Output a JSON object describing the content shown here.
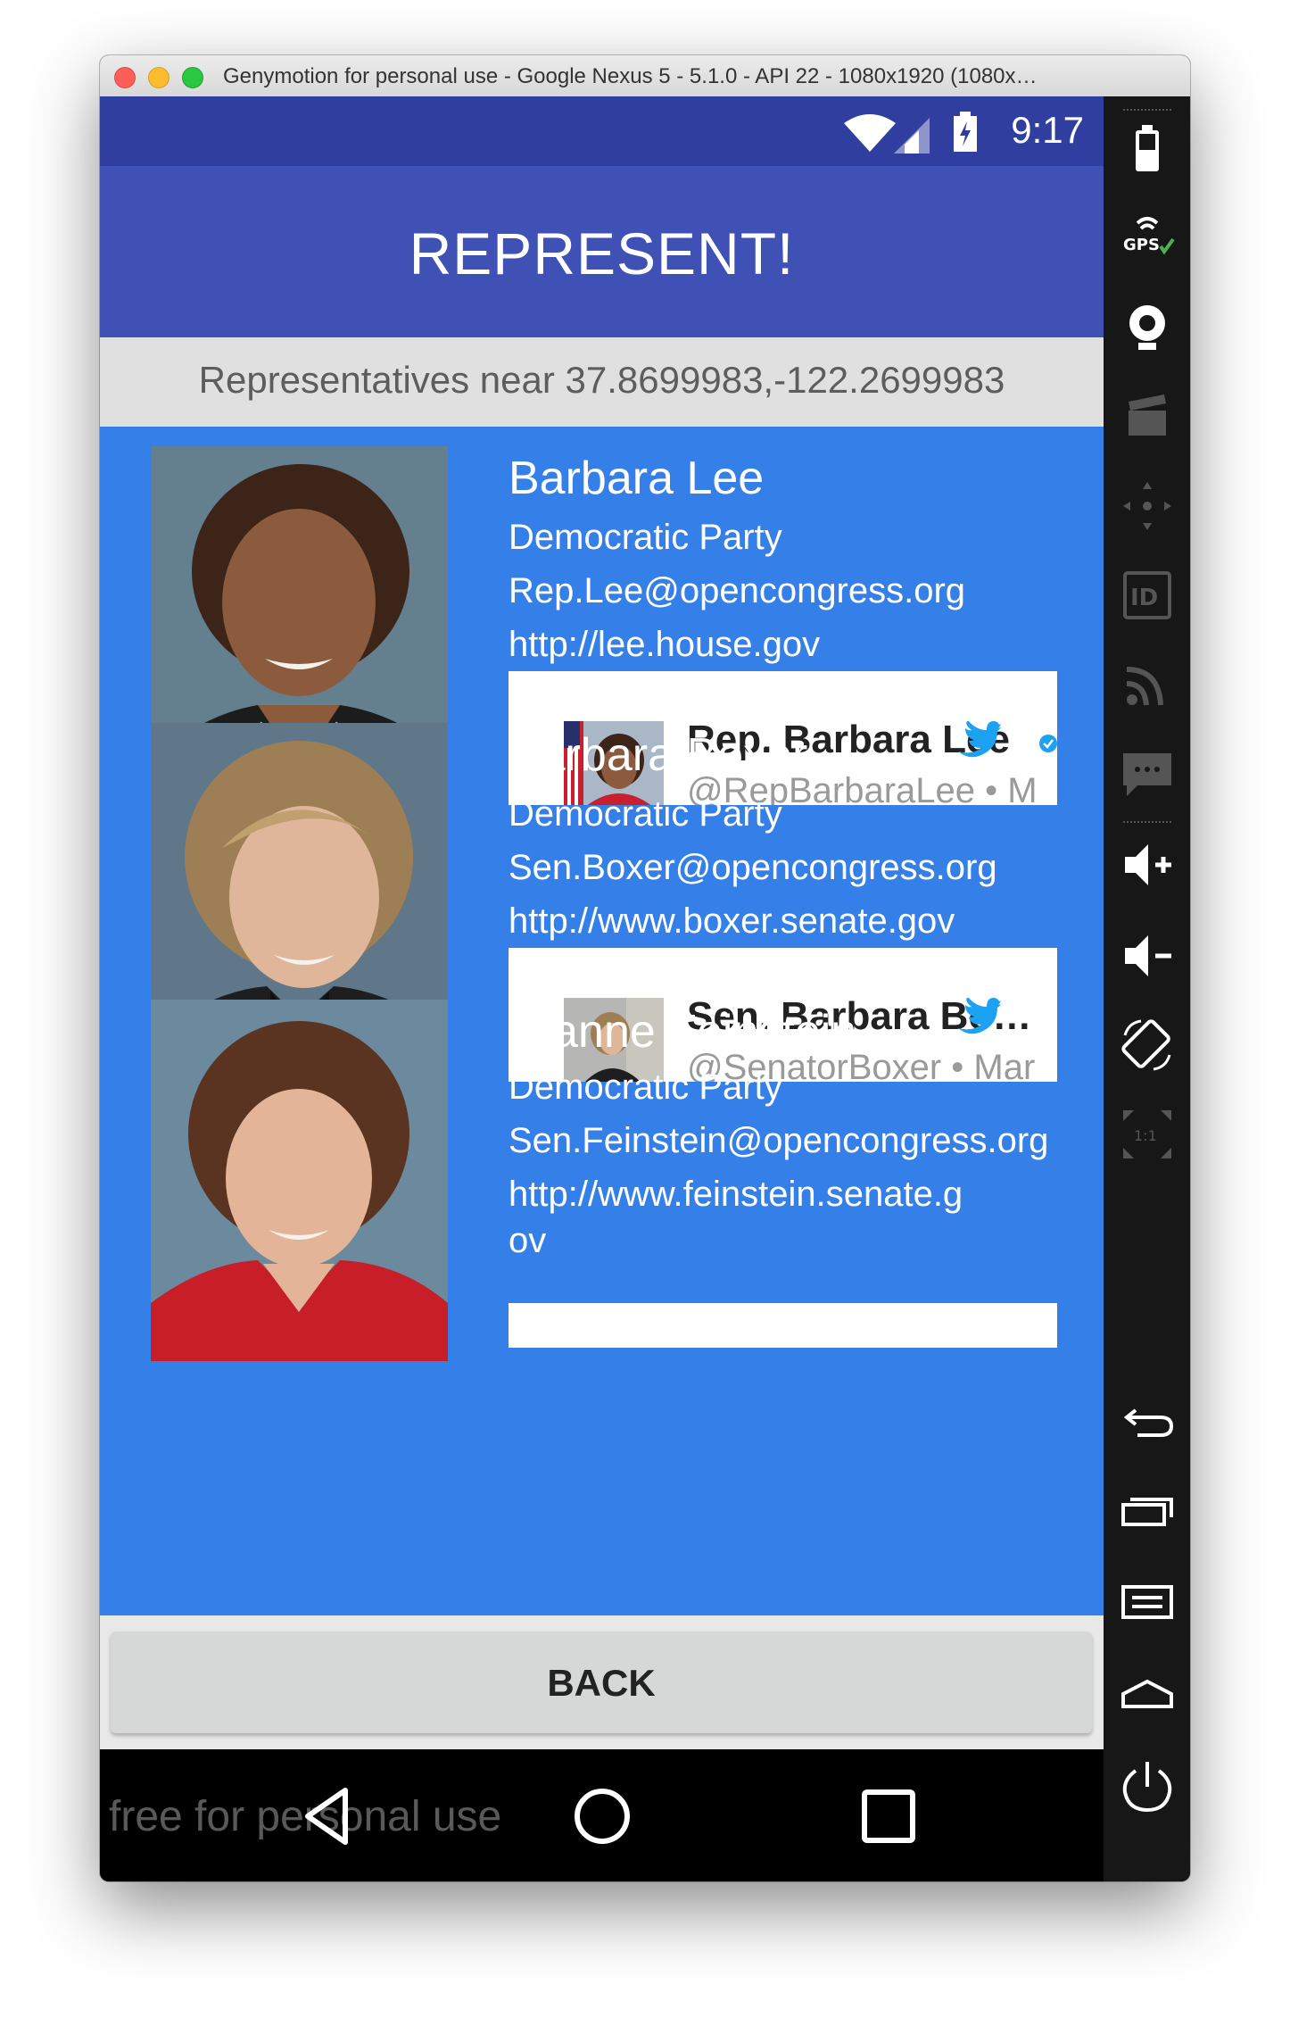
{
  "window": {
    "title": "Genymotion for personal use - Google Nexus 5 - 5.1.0 - API 22 - 1080x1920 (1080x…"
  },
  "status_bar": {
    "time": "9:17"
  },
  "app": {
    "title": "REPRESENT!",
    "subheader": "Representatives near 37.8699983,-122.2699983",
    "back_label": "BACK"
  },
  "representatives": [
    {
      "name": "Barbara Lee",
      "party": "Democratic Party",
      "email": "Rep.Lee@opencongress.org",
      "website": "http://lee.house.gov",
      "tweet": {
        "display_name": "Rep. Barbara Lee",
        "handle": "@RepBarbaraLee • M"
      }
    },
    {
      "name": "Barbara Boxer",
      "party": "Democratic Party",
      "email": "Sen.Boxer@opencongress.org",
      "website": "http://www.boxer.senate.gov",
      "tweet": {
        "display_name": "Sen. Barbara Bo…",
        "handle": "@SenatorBoxer • Mar"
      }
    },
    {
      "name": "Dianne Feinstein",
      "party": "Democratic Party",
      "email": "Sen.Feinstein@opencongress.org",
      "website": "http://www.feinstein.senate.gov"
    }
  ],
  "watermark": "free for personal use",
  "sidebar": {
    "items": [
      "battery-icon",
      "gps-icon",
      "webcam-icon",
      "video-capture-icon",
      "dpad-icon",
      "device-id-icon",
      "network-icon",
      "sms-icon",
      "volume-up-icon",
      "volume-down-icon",
      "rotate-icon",
      "scale-icon",
      "back-icon",
      "recent-apps-icon",
      "menu-icon",
      "home-icon",
      "power-icon"
    ],
    "gps_label": "GPS",
    "id_label": "ID",
    "scale_label": "1:1"
  },
  "colors": {
    "primary": "#3f51b5",
    "primary_dark": "#303f9f",
    "list_background": "#3580e8",
    "twitter_blue": "#1da1f2"
  }
}
